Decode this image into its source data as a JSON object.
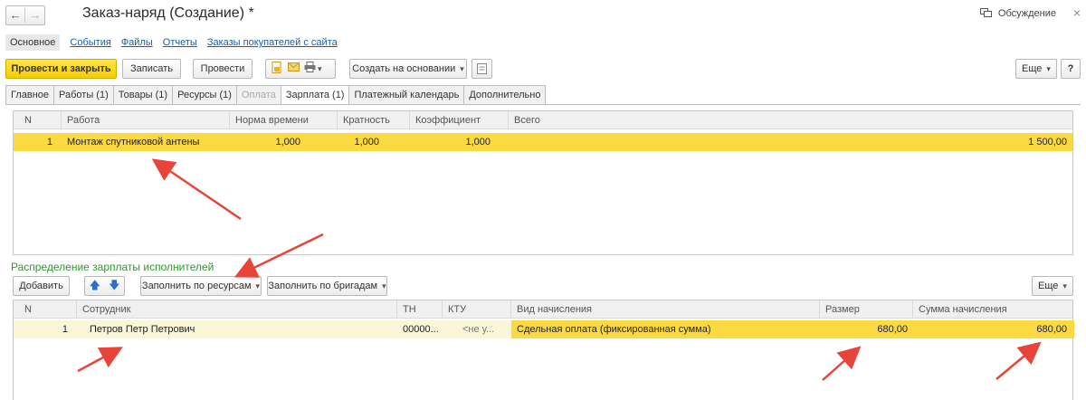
{
  "window": {
    "title": "Заказ-наряд (Создание) *",
    "discussion_label": "Обсуждение",
    "close_glyph": "×"
  },
  "nav": {
    "back_glyph": "←",
    "forward_glyph": "→"
  },
  "sections": [
    {
      "label": "Основное"
    },
    {
      "label": "События"
    },
    {
      "label": "Файлы"
    },
    {
      "label": "Отчеты"
    },
    {
      "label": "Заказы покупателей с сайта"
    }
  ],
  "toolbar": {
    "post_close_label": "Провести и закрыть",
    "save_label": "Записать",
    "post_label": "Провести",
    "create_based_label": "Создать на основании",
    "more_label": "Еще",
    "help_label": "?"
  },
  "tabs": [
    {
      "label": "Главное"
    },
    {
      "label": "Работы (1)"
    },
    {
      "label": "Товары (1)"
    },
    {
      "label": "Ресурсы (1)"
    },
    {
      "label": "Оплата"
    },
    {
      "label": "Зарплата (1)"
    },
    {
      "label": "Платежный календарь"
    },
    {
      "label": "Дополнительно"
    }
  ],
  "works_table": {
    "columns": [
      "N",
      "Работа",
      "Норма времени",
      "Кратность",
      "Коэффициент",
      "Всего"
    ],
    "rows": [
      {
        "n": "1",
        "work": "Монтаж спутниковой антены",
        "norm": "1,000",
        "multiplicity": "1,000",
        "coefficient": "1,000",
        "total": "1 500,00"
      }
    ]
  },
  "salary": {
    "group_title": "Распределение зарплаты исполнителей",
    "add_label": "Добавить",
    "fill_resources_label": "Заполнить по ресурсам",
    "fill_brigades_label": "Заполнить по бригадам",
    "more_label": "Еще",
    "columns": [
      "N",
      "Сотрудник",
      "ТН",
      "КТУ",
      "Вид начисления",
      "Размер",
      "Сумма начисления"
    ],
    "rows": [
      {
        "n": "1",
        "employee": "Петров Петр Петрович",
        "tn": "00000...",
        "ktu": "<не у...",
        "accrual_type": "Сдельная оплата (фиксированная сумма)",
        "size": "680,00",
        "amount": "680,00"
      }
    ]
  },
  "colors": {
    "accent_yellow": "#fbd940",
    "row_light_yellow": "#fcf6d8",
    "group_title_green": "#2d9a2d",
    "link_blue": "#1a5fa8",
    "arrow_red": "#e8443a"
  },
  "icons": {
    "discussion": "chat-bubble-icon",
    "print": "printer-icon",
    "mail": "envelope-icon",
    "doc": "document-icon",
    "up": "arrow-up-icon",
    "down": "arrow-down-icon"
  }
}
